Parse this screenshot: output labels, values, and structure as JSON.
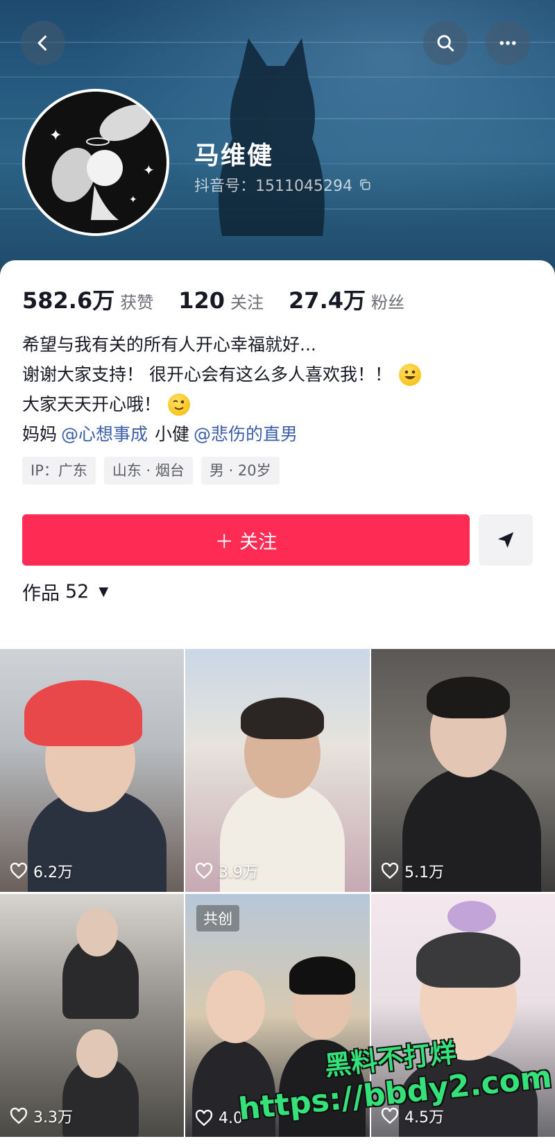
{
  "profile": {
    "name": "马维健",
    "douyin_id": "抖音号：1511045294"
  },
  "stats": [
    {
      "value": "582.6万",
      "label": "获赞"
    },
    {
      "value": "120",
      "label": "关注"
    },
    {
      "value": "27.4万",
      "label": "粉丝"
    }
  ],
  "bio": {
    "line1": "希望与我有关的所有人开心幸福就好...",
    "line2": "谢谢大家支持！ 很开心会有这么多人喜欢我！！",
    "line3": "大家天天开心哦！",
    "line4_prefix": "妈妈",
    "mention1": "@心想事成",
    "line4_middle": "小健",
    "mention2": "@悲伤的直男"
  },
  "tags": [
    "IP：广东",
    "山东 · 烟台",
    "男 · 20岁"
  ],
  "actions": {
    "follow_label": "＋ 关注"
  },
  "works": {
    "label": "作品",
    "count": "52"
  },
  "videos": [
    {
      "likes": "6.2万",
      "collab": ""
    },
    {
      "likes": "3.9万",
      "collab": ""
    },
    {
      "likes": "5.1万",
      "collab": ""
    },
    {
      "likes": "3.3万",
      "collab": ""
    },
    {
      "likes": "4.0",
      "collab": "共创"
    },
    {
      "likes": "4.5万",
      "collab": ""
    }
  ],
  "watermark": {
    "line1": "黑料不打烊",
    "line2": "https://bbdy2.com"
  },
  "colors": {
    "accent": "#fe2c55",
    "mention": "#3a5fa8",
    "banner": "#26597f"
  }
}
